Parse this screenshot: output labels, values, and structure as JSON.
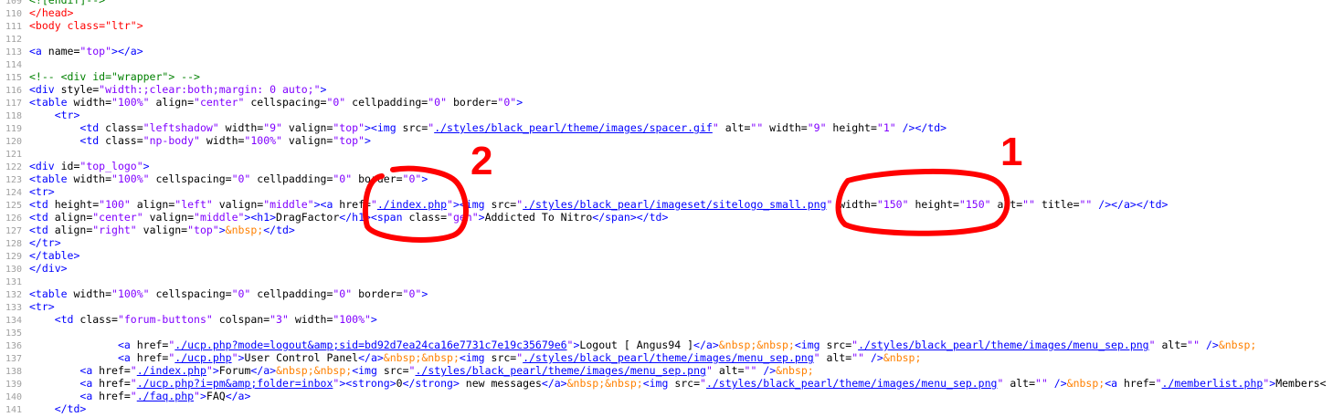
{
  "colors": {
    "tag": "#0000ff",
    "head_tag": "#ff0000",
    "attribute": "#000000",
    "value": "#8000ff",
    "url": "#0000ff",
    "comment": "#008000",
    "entity": "#ff8000",
    "line_number": "#a0a0a0",
    "annotation": "#ff0000"
  },
  "lines": [
    {
      "n": "109",
      "t": [
        [
          "cmt",
          "<![endif]-->"
        ]
      ]
    },
    {
      "n": "110",
      "t": [
        [
          "tagr",
          "</head>"
        ]
      ]
    },
    {
      "n": "111",
      "t": [
        [
          "tagr",
          "<body class=\"ltr\">"
        ]
      ]
    },
    {
      "n": "112",
      "t": []
    },
    {
      "n": "113",
      "t": [
        [
          "tag",
          "<a"
        ],
        [
          "attr",
          " name="
        ],
        [
          "val",
          "\"top\""
        ],
        [
          "tag",
          "></a>"
        ]
      ]
    },
    {
      "n": "114",
      "t": []
    },
    {
      "n": "115",
      "t": [
        [
          "cmt",
          "<!-- <div id=\"wrapper\"> -->"
        ]
      ]
    },
    {
      "n": "116",
      "t": [
        [
          "tag",
          "<div"
        ],
        [
          "attr",
          " style="
        ],
        [
          "val",
          "\"width:;clear:both;margin: 0 auto;\""
        ],
        [
          "tag",
          ">"
        ]
      ]
    },
    {
      "n": "117",
      "t": [
        [
          "tag",
          "<table"
        ],
        [
          "attr",
          " width="
        ],
        [
          "val",
          "\"100%\""
        ],
        [
          "attr",
          " align="
        ],
        [
          "val",
          "\"center\""
        ],
        [
          "attr",
          " cellspacing="
        ],
        [
          "val",
          "\"0\""
        ],
        [
          "attr",
          " cellpadding="
        ],
        [
          "val",
          "\"0\""
        ],
        [
          "attr",
          " border="
        ],
        [
          "val",
          "\"0\""
        ],
        [
          "tag",
          ">"
        ]
      ]
    },
    {
      "n": "118",
      "t": [
        [
          "txt",
          "    "
        ],
        [
          "tag",
          "<tr>"
        ]
      ]
    },
    {
      "n": "119",
      "t": [
        [
          "txt",
          "        "
        ],
        [
          "tag",
          "<td"
        ],
        [
          "attr",
          " class="
        ],
        [
          "val",
          "\"leftshadow\""
        ],
        [
          "attr",
          " width="
        ],
        [
          "val",
          "\"9\""
        ],
        [
          "attr",
          " valign="
        ],
        [
          "val",
          "\"top\""
        ],
        [
          "tag",
          "><img"
        ],
        [
          "attr",
          " src="
        ],
        [
          "val",
          "\""
        ],
        [
          "url",
          "./styles/black_pearl/theme/images/spacer.gif"
        ],
        [
          "val",
          "\""
        ],
        [
          "attr",
          " alt="
        ],
        [
          "val",
          "\"\""
        ],
        [
          "attr",
          " width="
        ],
        [
          "val",
          "\"9\""
        ],
        [
          "attr",
          " height="
        ],
        [
          "val",
          "\"1\""
        ],
        [
          "tag",
          " /></td>"
        ]
      ]
    },
    {
      "n": "120",
      "t": [
        [
          "txt",
          "        "
        ],
        [
          "tag",
          "<td"
        ],
        [
          "attr",
          " class="
        ],
        [
          "val",
          "\"np-body\""
        ],
        [
          "attr",
          " width="
        ],
        [
          "val",
          "\"100%\""
        ],
        [
          "attr",
          " valign="
        ],
        [
          "val",
          "\"top\""
        ],
        [
          "tag",
          ">"
        ]
      ]
    },
    {
      "n": "121",
      "t": []
    },
    {
      "n": "122",
      "t": [
        [
          "tag",
          "<div"
        ],
        [
          "attr",
          " id="
        ],
        [
          "val",
          "\"top_logo\""
        ],
        [
          "tag",
          ">"
        ]
      ]
    },
    {
      "n": "123",
      "t": [
        [
          "tag",
          "<table"
        ],
        [
          "attr",
          " width="
        ],
        [
          "val",
          "\"100%\""
        ],
        [
          "attr",
          " cellspacing="
        ],
        [
          "val",
          "\"0\""
        ],
        [
          "attr",
          " cellpadding="
        ],
        [
          "val",
          "\"0\""
        ],
        [
          "attr",
          " border="
        ],
        [
          "val",
          "\"0\""
        ],
        [
          "tag",
          ">"
        ]
      ]
    },
    {
      "n": "124",
      "t": [
        [
          "tag",
          "<tr>"
        ]
      ]
    },
    {
      "n": "125",
      "t": [
        [
          "tag",
          "<td"
        ],
        [
          "attr",
          " height="
        ],
        [
          "val",
          "\"100\""
        ],
        [
          "attr",
          " align="
        ],
        [
          "val",
          "\"left\""
        ],
        [
          "attr",
          " valign="
        ],
        [
          "val",
          "\"middle\""
        ],
        [
          "tag",
          "><a"
        ],
        [
          "attr",
          " href="
        ],
        [
          "val",
          "\""
        ],
        [
          "url",
          "./index.php"
        ],
        [
          "val",
          "\""
        ],
        [
          "tag",
          "><img"
        ],
        [
          "attr",
          " src="
        ],
        [
          "val",
          "\""
        ],
        [
          "url",
          "./styles/black_pearl/imageset/sitelogo_small.png"
        ],
        [
          "val",
          "\""
        ],
        [
          "attr",
          " width="
        ],
        [
          "val",
          "\"150\""
        ],
        [
          "attr",
          " height="
        ],
        [
          "val",
          "\"150\""
        ],
        [
          "attr",
          " alt="
        ],
        [
          "val",
          "\"\""
        ],
        [
          "attr",
          " title="
        ],
        [
          "val",
          "\"\""
        ],
        [
          "tag",
          " /></a></td>"
        ]
      ]
    },
    {
      "n": "126",
      "t": [
        [
          "tag",
          "<td"
        ],
        [
          "attr",
          " align="
        ],
        [
          "val",
          "\"center\""
        ],
        [
          "attr",
          " valign="
        ],
        [
          "val",
          "\"middle\""
        ],
        [
          "tag",
          "><h1>"
        ],
        [
          "txt",
          "DragFactor"
        ],
        [
          "tag",
          "</h1><span"
        ],
        [
          "attr",
          " class="
        ],
        [
          "val",
          "\"gen\""
        ],
        [
          "tag",
          ">"
        ],
        [
          "txt",
          "Addicted To Nitro"
        ],
        [
          "tag",
          "</span></td>"
        ]
      ]
    },
    {
      "n": "127",
      "t": [
        [
          "tag",
          "<td"
        ],
        [
          "attr",
          " align="
        ],
        [
          "val",
          "\"right\""
        ],
        [
          "attr",
          " valign="
        ],
        [
          "val",
          "\"top\""
        ],
        [
          "tag",
          ">"
        ],
        [
          "ent",
          "&nbsp;"
        ],
        [
          "tag",
          "</td>"
        ]
      ]
    },
    {
      "n": "128",
      "t": [
        [
          "tag",
          "</tr>"
        ]
      ]
    },
    {
      "n": "129",
      "t": [
        [
          "tag",
          "</table>"
        ]
      ]
    },
    {
      "n": "130",
      "t": [
        [
          "tag",
          "</div>"
        ]
      ]
    },
    {
      "n": "131",
      "t": []
    },
    {
      "n": "132",
      "t": [
        [
          "tag",
          "<table"
        ],
        [
          "attr",
          " width="
        ],
        [
          "val",
          "\"100%\""
        ],
        [
          "attr",
          " cellspacing="
        ],
        [
          "val",
          "\"0\""
        ],
        [
          "attr",
          " cellpadding="
        ],
        [
          "val",
          "\"0\""
        ],
        [
          "attr",
          " border="
        ],
        [
          "val",
          "\"0\""
        ],
        [
          "tag",
          ">"
        ]
      ]
    },
    {
      "n": "133",
      "t": [
        [
          "tag",
          "<tr>"
        ]
      ]
    },
    {
      "n": "134",
      "t": [
        [
          "txt",
          "    "
        ],
        [
          "tag",
          "<td"
        ],
        [
          "attr",
          " class="
        ],
        [
          "val",
          "\"forum-buttons\""
        ],
        [
          "attr",
          " colspan="
        ],
        [
          "val",
          "\"3\""
        ],
        [
          "attr",
          " width="
        ],
        [
          "val",
          "\"100%\""
        ],
        [
          "tag",
          ">"
        ]
      ]
    },
    {
      "n": "135",
      "t": []
    },
    {
      "n": "136",
      "t": [
        [
          "txt",
          "              "
        ],
        [
          "tag",
          "<a"
        ],
        [
          "attr",
          " href="
        ],
        [
          "val",
          "\""
        ],
        [
          "url",
          "./ucp.php?mode=logout&amp;sid=bd92d7ea24ca16e7731c7e19c35679e6"
        ],
        [
          "val",
          "\""
        ],
        [
          "tag",
          ">"
        ],
        [
          "txt",
          "Logout [ Angus94 ]"
        ],
        [
          "tag",
          "</a>"
        ],
        [
          "ent",
          "&nbsp;&nbsp;"
        ],
        [
          "tag",
          "<img"
        ],
        [
          "attr",
          " src="
        ],
        [
          "val",
          "\""
        ],
        [
          "url",
          "./styles/black_pearl/theme/images/menu_sep.png"
        ],
        [
          "val",
          "\""
        ],
        [
          "attr",
          " alt="
        ],
        [
          "val",
          "\"\""
        ],
        [
          "tag",
          " />"
        ],
        [
          "ent",
          "&nbsp;"
        ]
      ]
    },
    {
      "n": "137",
      "t": [
        [
          "txt",
          "              "
        ],
        [
          "tag",
          "<a"
        ],
        [
          "attr",
          " href="
        ],
        [
          "val",
          "\""
        ],
        [
          "url",
          "./ucp.php"
        ],
        [
          "val",
          "\""
        ],
        [
          "tag",
          ">"
        ],
        [
          "txt",
          "User Control Panel"
        ],
        [
          "tag",
          "</a>"
        ],
        [
          "ent",
          "&nbsp;&nbsp;"
        ],
        [
          "tag",
          "<img"
        ],
        [
          "attr",
          " src="
        ],
        [
          "val",
          "\""
        ],
        [
          "url",
          "./styles/black_pearl/theme/images/menu_sep.png"
        ],
        [
          "val",
          "\""
        ],
        [
          "attr",
          " alt="
        ],
        [
          "val",
          "\"\""
        ],
        [
          "tag",
          " />"
        ],
        [
          "ent",
          "&nbsp;"
        ]
      ]
    },
    {
      "n": "138",
      "t": [
        [
          "txt",
          "        "
        ],
        [
          "tag",
          "<a"
        ],
        [
          "attr",
          " href="
        ],
        [
          "val",
          "\""
        ],
        [
          "url",
          "./index.php"
        ],
        [
          "val",
          "\""
        ],
        [
          "tag",
          ">"
        ],
        [
          "txt",
          "Forum"
        ],
        [
          "tag",
          "</a>"
        ],
        [
          "ent",
          "&nbsp;&nbsp;"
        ],
        [
          "tag",
          "<img"
        ],
        [
          "attr",
          " src="
        ],
        [
          "val",
          "\""
        ],
        [
          "url",
          "./styles/black_pearl/theme/images/menu_sep.png"
        ],
        [
          "val",
          "\""
        ],
        [
          "attr",
          " alt="
        ],
        [
          "val",
          "\"\""
        ],
        [
          "tag",
          " />"
        ],
        [
          "ent",
          "&nbsp;"
        ]
      ]
    },
    {
      "n": "139",
      "t": [
        [
          "txt",
          "        "
        ],
        [
          "tag",
          "<a"
        ],
        [
          "attr",
          " href="
        ],
        [
          "val",
          "\""
        ],
        [
          "url",
          "./ucp.php?i=pm&amp;folder=inbox"
        ],
        [
          "val",
          "\""
        ],
        [
          "tag",
          "><strong>"
        ],
        [
          "txt",
          "0"
        ],
        [
          "tag",
          "</strong>"
        ],
        [
          "txt",
          " new messages"
        ],
        [
          "tag",
          "</a>"
        ],
        [
          "ent",
          "&nbsp;&nbsp;"
        ],
        [
          "tag",
          "<img"
        ],
        [
          "attr",
          " src="
        ],
        [
          "val",
          "\""
        ],
        [
          "url",
          "./styles/black_pearl/theme/images/menu_sep.png"
        ],
        [
          "val",
          "\""
        ],
        [
          "attr",
          " alt="
        ],
        [
          "val",
          "\"\""
        ],
        [
          "tag",
          " />"
        ],
        [
          "ent",
          "&nbsp;"
        ],
        [
          "tag",
          "<a"
        ],
        [
          "attr",
          " href="
        ],
        [
          "val",
          "\""
        ],
        [
          "url",
          "./memberlist.php"
        ],
        [
          "val",
          "\""
        ],
        [
          "tag",
          ">"
        ],
        [
          "txt",
          "Members<"
        ]
      ]
    },
    {
      "n": "140",
      "t": [
        [
          "txt",
          "        "
        ],
        [
          "tag",
          "<a"
        ],
        [
          "attr",
          " href="
        ],
        [
          "val",
          "\""
        ],
        [
          "url",
          "./faq.php"
        ],
        [
          "val",
          "\""
        ],
        [
          "tag",
          ">"
        ],
        [
          "txt",
          "FAQ"
        ],
        [
          "tag",
          "</a>"
        ]
      ]
    },
    {
      "n": "141",
      "t": [
        [
          "txt",
          "    "
        ],
        [
          "tag",
          "</td>"
        ]
      ]
    }
  ],
  "annotations": {
    "number_1": "1",
    "number_2": "2"
  }
}
